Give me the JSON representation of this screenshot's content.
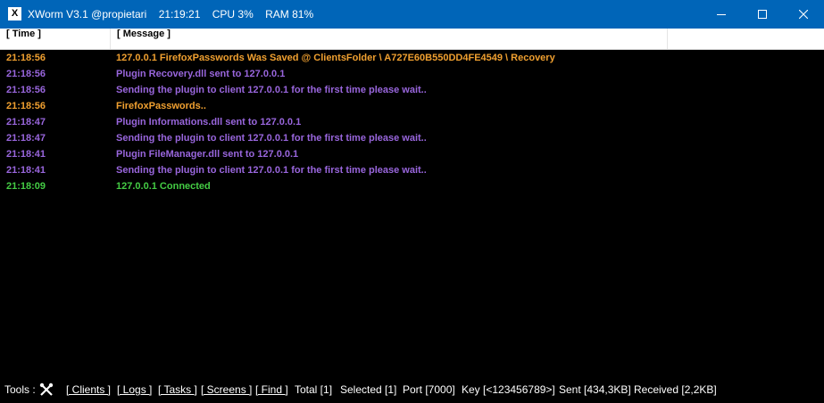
{
  "window": {
    "title_app": "XWorm V3.1 @propietari",
    "title_time": "21:19:21",
    "title_cpu": "CPU 3%",
    "title_ram": "RAM 81%",
    "icon_letter": "X"
  },
  "columns": {
    "time": "[ Time ]",
    "message": "[ Message ]"
  },
  "logs": [
    {
      "time": "21:18:56",
      "message": "127.0.0.1 FirefoxPasswords Was Saved @ ClientsFolder \\ A727E60B550DD4FE4549 \\ Recovery",
      "color": "#f0a030"
    },
    {
      "time": "21:18:56",
      "message": "Plugin Recovery.dll sent to 127.0.0.1",
      "color": "#9966dd"
    },
    {
      "time": "21:18:56",
      "message": "Sending the plugin to client 127.0.0.1 for the first time please wait..",
      "color": "#9966dd"
    },
    {
      "time": "21:18:56",
      "message": "FirefoxPasswords..",
      "color": "#f0a030"
    },
    {
      "time": "21:18:47",
      "message": "Plugin Informations.dll sent to 127.0.0.1",
      "color": "#9966dd"
    },
    {
      "time": "21:18:47",
      "message": "Sending the plugin to client 127.0.0.1 for the first time please wait..",
      "color": "#9966dd"
    },
    {
      "time": "21:18:41",
      "message": "Plugin FileManager.dll sent to 127.0.0.1",
      "color": "#9966dd"
    },
    {
      "time": "21:18:41",
      "message": "Sending the plugin to client 127.0.0.1 for the first time please wait..",
      "color": "#9966dd"
    },
    {
      "time": "21:18:09",
      "message": "127.0.0.1 Connected",
      "color": "#44cc44"
    }
  ],
  "statusbar": {
    "tools_label": "Tools :",
    "tools_icon": "tools-icon",
    "clients": "[ Clients ]",
    "logs": "[ Logs ]",
    "tasks": "[ Tasks ]",
    "screens": "[ Screens ]",
    "find": "[ Find ]",
    "total": "Total [1]",
    "selected": "Selected [1]",
    "port": "Port [7000]",
    "key": "Key [<123456789>]",
    "sent": "Sent [434,3KB]",
    "received": "Received [2,2KB]"
  },
  "colors": {
    "titlebar": "#0065b8",
    "background": "#000000",
    "header": "#ffffff"
  }
}
